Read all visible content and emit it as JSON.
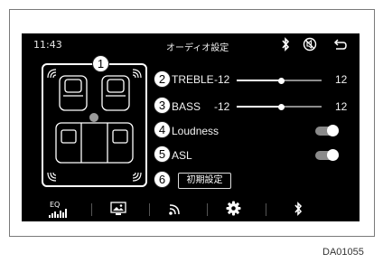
{
  "status_bar": {
    "time": "11:43",
    "title": "オーディオ設定"
  },
  "icons": {
    "bluetooth": "bluetooth-icon",
    "mute": "mute-icon",
    "back": "back-icon"
  },
  "callouts": [
    "1",
    "2",
    "3",
    "4",
    "5",
    "6"
  ],
  "settings": {
    "treble": {
      "label": "TREBLE",
      "min": "-12",
      "max": "12",
      "level": 0
    },
    "bass": {
      "label": "BASS",
      "min": "-12",
      "max": "12",
      "level": 0
    },
    "loudness": {
      "label": "Loudness",
      "on": true
    },
    "asl": {
      "label": "ASL",
      "on": true
    },
    "reset_label": "初期設定"
  },
  "bottom_bar": {
    "eq_label": "EQ",
    "items": [
      "equalizer-icon",
      "picture-icon",
      "radio-waves-icon",
      "gear-icon",
      "bluetooth-icon"
    ]
  },
  "caption": "DA01055",
  "colors": {
    "screen_bg": "#000000",
    "foreground": "#ffffff",
    "inactive": "#8c8c8c"
  }
}
